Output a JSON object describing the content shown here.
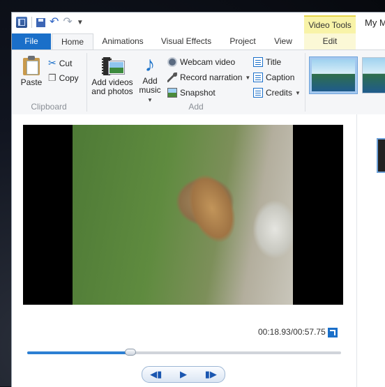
{
  "app": {
    "window_title": "My M",
    "contextual_tab_group": "Video Tools"
  },
  "tabs": [
    {
      "label": "File"
    },
    {
      "label": "Home"
    },
    {
      "label": "Animations"
    },
    {
      "label": "Visual Effects"
    },
    {
      "label": "Project"
    },
    {
      "label": "View"
    },
    {
      "label": "Edit"
    }
  ],
  "ribbon": {
    "clipboard": {
      "group_label": "Clipboard",
      "paste": "Paste",
      "cut": "Cut",
      "copy": "Copy"
    },
    "add": {
      "group_label": "Add",
      "add_videos_line1": "Add videos",
      "add_videos_line2": "and photos",
      "add_music_line1": "Add",
      "add_music_line2": "music",
      "webcam": "Webcam video",
      "narration": "Record narration",
      "snapshot": "Snapshot",
      "title": "Title",
      "caption": "Caption",
      "credits": "Credits"
    }
  },
  "player": {
    "time_current": "00:18.93",
    "time_total": "00:57.75",
    "progress_fraction": 0.328
  },
  "colors": {
    "accent": "#1a6fc9",
    "contextual": "#f8f3a8"
  }
}
